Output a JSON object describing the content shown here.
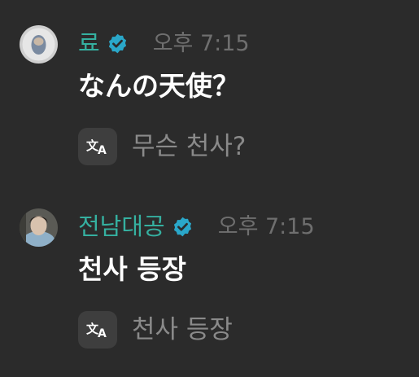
{
  "messages": [
    {
      "author": "료",
      "time": "오후 7:15",
      "text": "なんの天使？",
      "translation": "무슨 천사?"
    },
    {
      "author": "전남대공",
      "time": "오후 7:15",
      "text": "천사 등장",
      "translation": "천사 등장"
    }
  ],
  "icons": {
    "verified": "verified-badge-icon",
    "translate": "translate-icon"
  },
  "colors": {
    "background": "#2b2b2b",
    "author_name": "#35b0a0",
    "verified_badge": "#2aa7c9",
    "time": "#6f6f6f",
    "message_text": "#ffffff",
    "translation_text": "#8a8a8a"
  }
}
